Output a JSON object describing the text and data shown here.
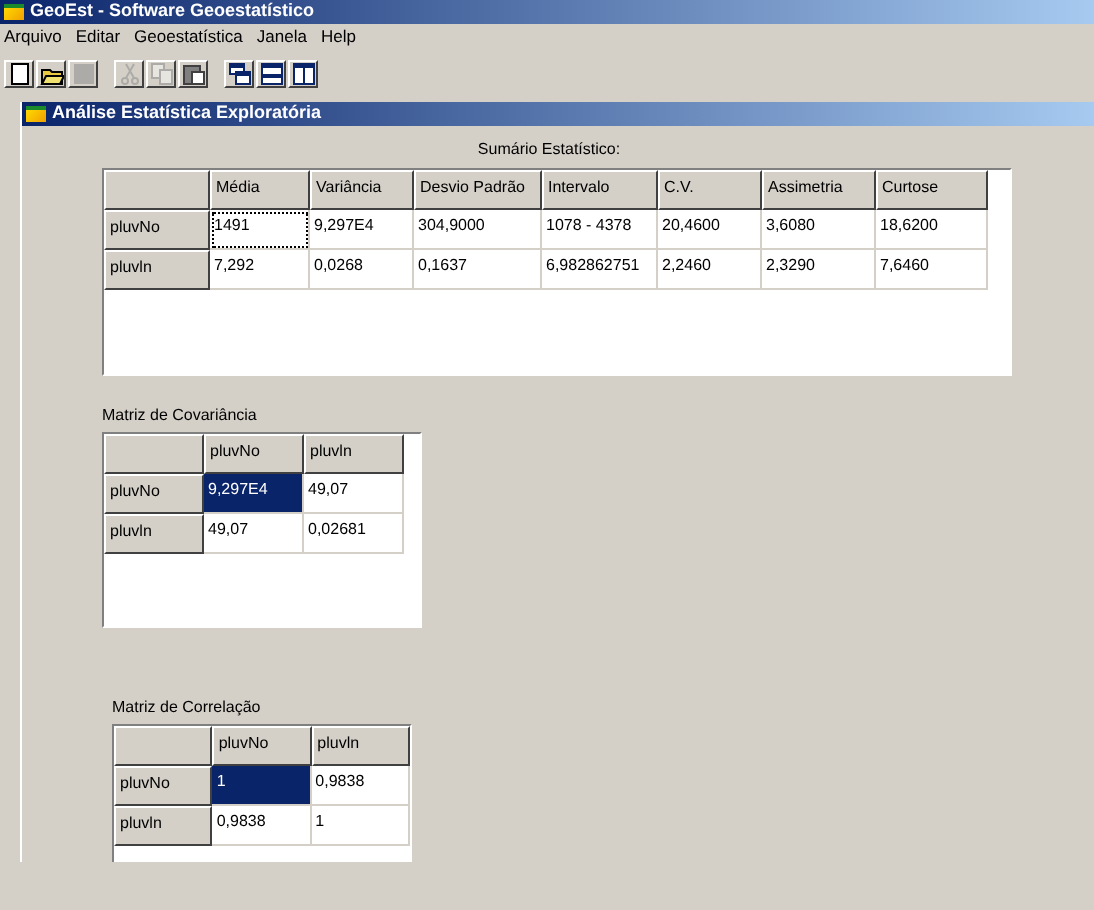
{
  "window": {
    "title": "GeoEst - Software Geoestatístico"
  },
  "menu": [
    "Arquivo",
    "Editar",
    "Geoestatística",
    "Janela",
    "Help"
  ],
  "toolbar": [
    {
      "kind": "new",
      "disabled": false
    },
    {
      "kind": "open",
      "disabled": false
    },
    {
      "kind": "save",
      "disabled": true
    },
    {
      "kind": "cut",
      "disabled": true
    },
    {
      "kind": "copy",
      "disabled": true
    },
    {
      "kind": "paste",
      "disabled": false
    },
    {
      "kind": "cascade",
      "disabled": false
    },
    {
      "kind": "tile-h",
      "disabled": false
    },
    {
      "kind": "tile-v",
      "disabled": false
    }
  ],
  "child_window": {
    "title": "Análise Estatística Exploratória"
  },
  "summary": {
    "title": "Sumário Estatístico:",
    "columns": [
      "Média",
      "Variância",
      "Desvio Padrão",
      "Intervalo",
      "C.V.",
      "Assimetria",
      "Curtose"
    ],
    "rows": [
      {
        "label": "pluvNo",
        "cells": [
          {
            "text": "1491",
            "selected": true
          },
          {
            "text": "9,297E4",
            "selected": false
          },
          {
            "text": "304,9000",
            "selected": false
          },
          {
            "text": "1078 - 4378",
            "selected": false
          },
          {
            "text": "20,4600",
            "selected": false
          },
          {
            "text": "3,6080",
            "selected": false
          },
          {
            "text": "18,6200",
            "selected": false
          }
        ]
      },
      {
        "label": "pluvln",
        "cells": [
          {
            "text": "7,292",
            "selected": false
          },
          {
            "text": "0,0268",
            "selected": false
          },
          {
            "text": "0,1637",
            "selected": false
          },
          {
            "text": "6,982862751",
            "selected": false
          },
          {
            "text": "2,2460",
            "selected": false
          },
          {
            "text": "2,3290",
            "selected": false
          },
          {
            "text": "7,6460",
            "selected": false
          }
        ]
      }
    ]
  },
  "covariance": {
    "title": "Matriz de Covariância",
    "columns": [
      "pluvNo",
      "pluvln"
    ],
    "rows": [
      {
        "label": "pluvNo",
        "cells": [
          {
            "text": "9,297E4",
            "selected": true
          },
          {
            "text": "49,07",
            "selected": false
          }
        ]
      },
      {
        "label": "pluvln",
        "cells": [
          {
            "text": "49,07",
            "selected": false
          },
          {
            "text": "0,02681",
            "selected": false
          }
        ]
      }
    ]
  },
  "correlation": {
    "title": "Matriz de Correlação",
    "columns": [
      "pluvNo",
      "pluvln"
    ],
    "rows": [
      {
        "label": "pluvNo",
        "cells": [
          {
            "text": "1",
            "selected": true
          },
          {
            "text": "0,9838",
            "selected": false
          }
        ]
      },
      {
        "label": "pluvln",
        "cells": [
          {
            "text": "0,9838",
            "selected": false
          },
          {
            "text": "1",
            "selected": false
          }
        ]
      }
    ]
  }
}
